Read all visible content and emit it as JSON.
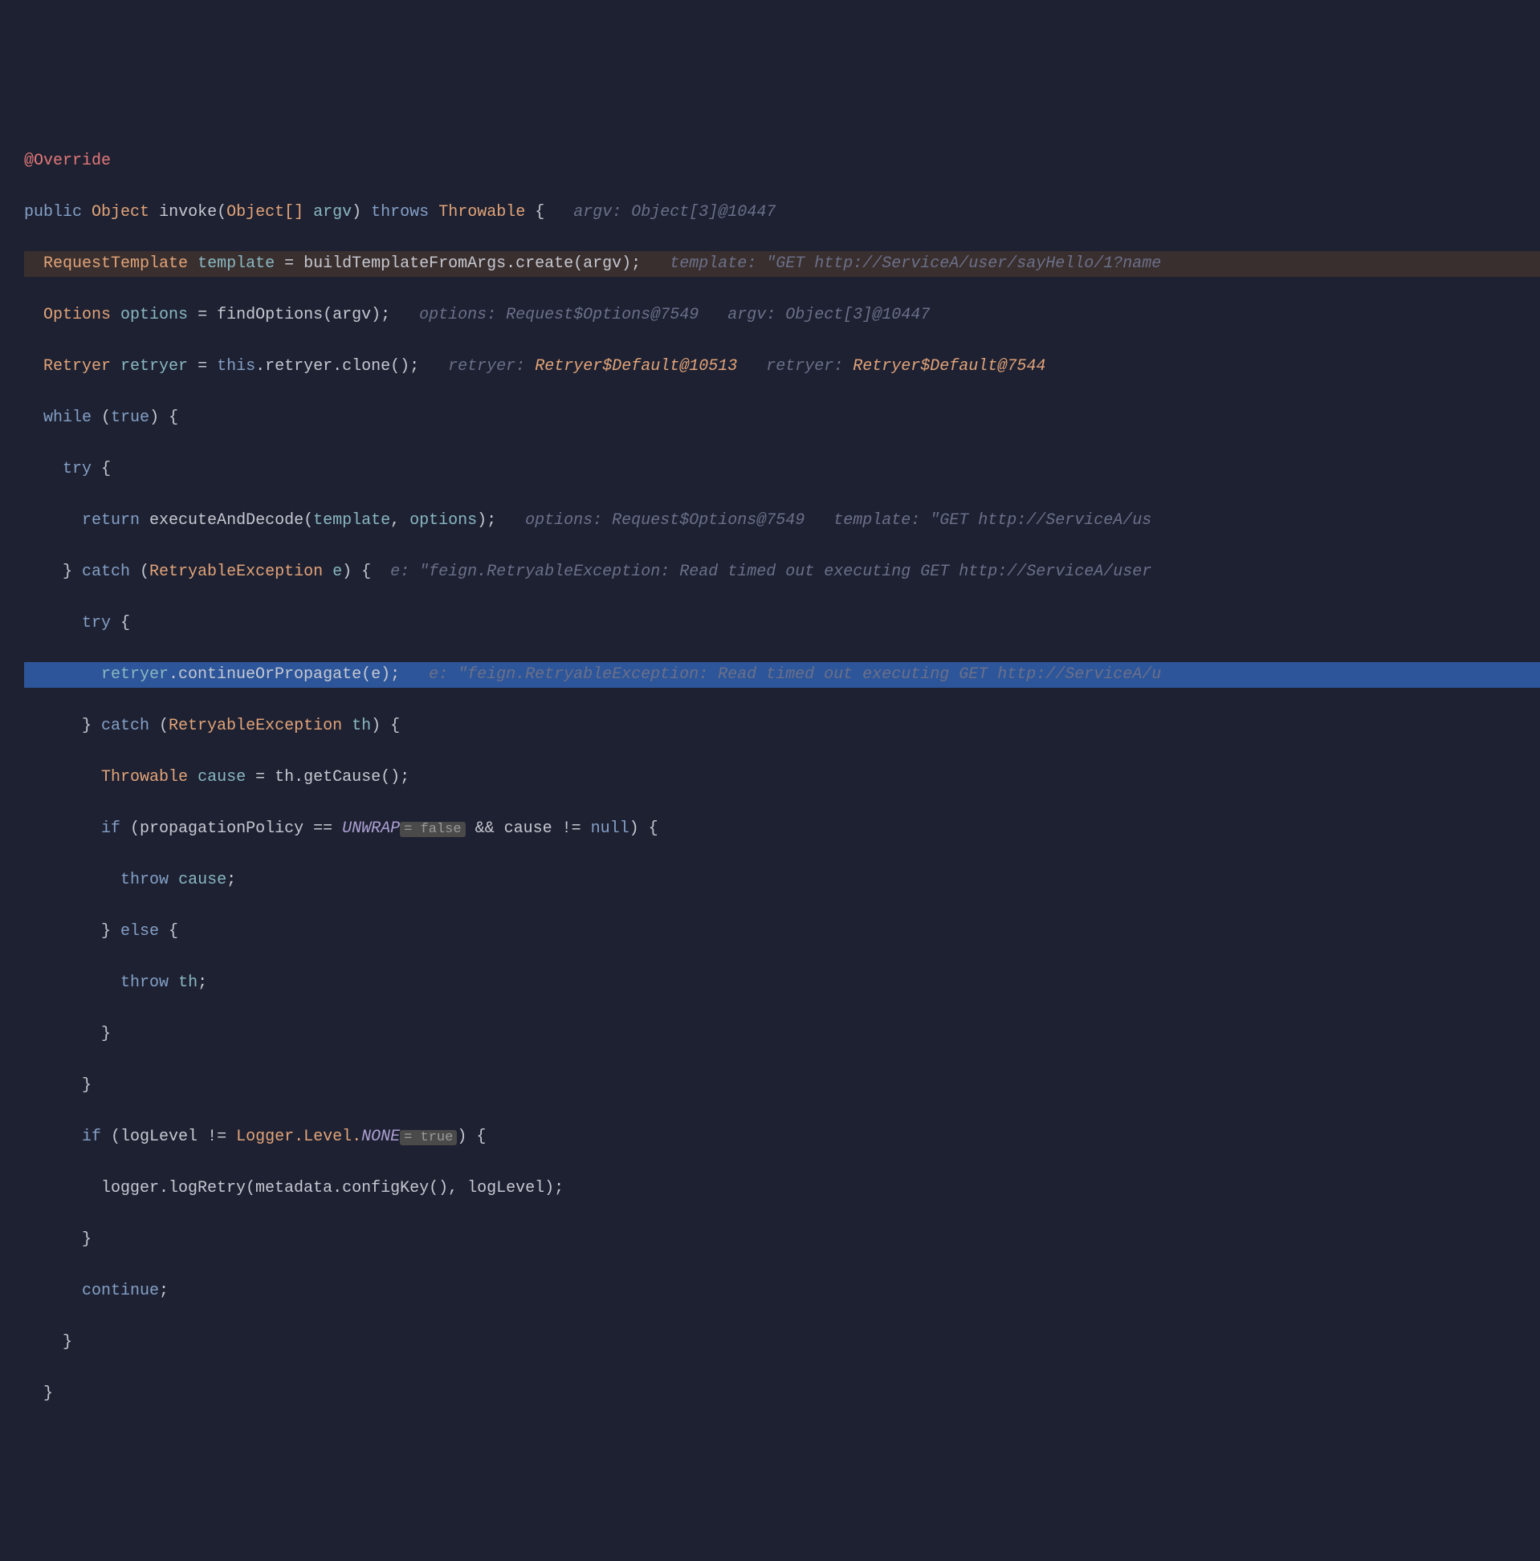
{
  "code": {
    "override": "@Override",
    "sig_public": "public",
    "sig_type": "Object",
    "sig_method": "invoke",
    "sig_param_type": "Object[]",
    "sig_param_name": "argv",
    "sig_throws": "throws",
    "sig_throwable": "Throwable",
    "sig_hint": "argv: Object[3]@10447",
    "l3_type": "RequestTemplate",
    "l3_var": "template",
    "l3_call": "buildTemplateFromArgs.create(argv);",
    "l3_hint": "template: \"GET http://ServiceA/user/sayHello/1?name",
    "l4_type": "Options",
    "l4_var": "options",
    "l4_call": "findOptions(argv);",
    "l4_hint1": "options: Request$Options@7549",
    "l4_hint2": "argv: Object[3]@10447",
    "l5_type": "Retryer",
    "l5_var": "retryer",
    "l5_this": "this",
    "l5_call": ".retryer.clone();",
    "l5_hint1_pre": "retryer: ",
    "l5_hint1_val": "Retryer$Default@10513",
    "l5_hint2_pre": "retryer: ",
    "l5_hint2_val": "Retryer$Default@7544",
    "l6_while": "while",
    "l6_true": "true",
    "l7_try": "try",
    "l8_return": "return",
    "l8_method": "executeAndDecode",
    "l8_arg1": "template",
    "l8_arg2": "options",
    "l8_hint1": "options: Request$Options@7549",
    "l8_hint2": "template: \"GET http://ServiceA/us",
    "l9_catch": "catch",
    "l9_type": "RetryableException",
    "l9_var": "e",
    "l9_hint": "e: \"feign.RetryableException: Read timed out executing GET http://ServiceA/user",
    "l10_try": "try",
    "l11_obj": "retryer",
    "l11_method": ".continueOrPropagate(e);",
    "l11_hint": "e: \"feign.RetryableException: Read timed out executing GET http://ServiceA/u",
    "l12_catch": "catch",
    "l12_type": "RetryableException",
    "l12_var": "th",
    "l13_type": "Throwable",
    "l13_var": "cause",
    "l13_call": "th.getCause();",
    "l14_if": "if",
    "l14_prop": "propagationPolicy",
    "l14_unwrap": "UNWRAP",
    "l14_eval1": "= false",
    "l14_and": "&&",
    "l14_cause": "cause",
    "l14_null": "null",
    "l15_throw": "throw",
    "l15_var": "cause",
    "l16_else": "else",
    "l17_throw": "throw",
    "l17_var": "th",
    "l20_if": "if",
    "l20_loglevel": "logLevel",
    "l20_logger": "Logger.Level.",
    "l20_none": "NONE",
    "l20_eval": "= true",
    "l21_call": "logger.logRetry(metadata.configKey(), logLevel);",
    "l23_continue": "continue"
  }
}
